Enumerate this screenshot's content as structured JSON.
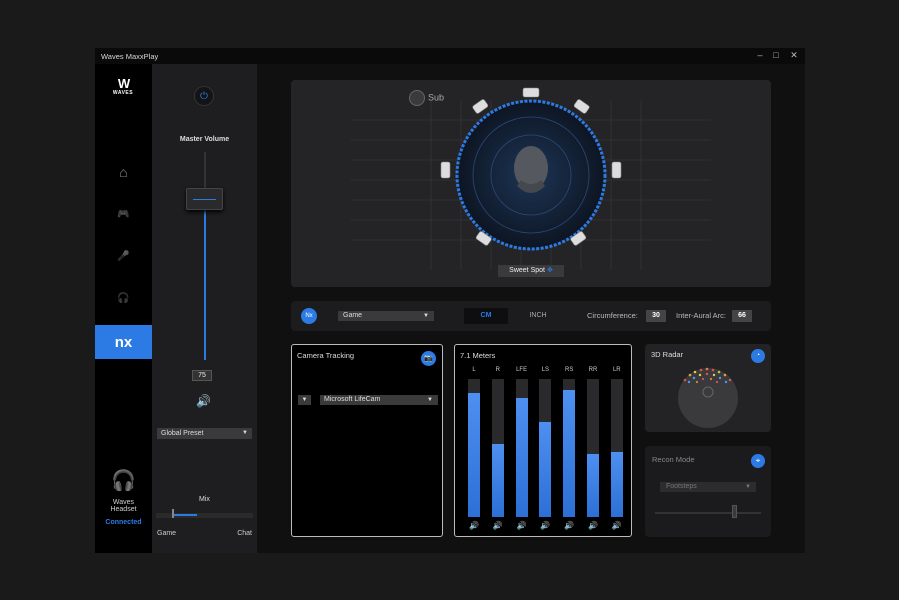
{
  "window": {
    "title": "Waves MaxxPlay",
    "minimize": "–",
    "maximize": "□",
    "close": "✕"
  },
  "rail": {
    "logo_mark": "W",
    "logo_text": "WAVES",
    "items": [
      {
        "icon": "home-icon",
        "glyph": "⌂"
      },
      {
        "icon": "gamepad-icon",
        "glyph": "🎮"
      },
      {
        "icon": "microphone-icon",
        "glyph": "🎤"
      },
      {
        "icon": "headphones-icon",
        "glyph": "🎧"
      },
      {
        "icon": "nx-icon",
        "glyph": "nx",
        "active": true
      }
    ],
    "headset_name": "Waves Headset",
    "headset_status": "Connected"
  },
  "mixer": {
    "master_label": "Master Volume",
    "volume_value": "75",
    "volume_level": 0.75,
    "preset_label": "Global Preset",
    "mix_label": "Mix",
    "mix_left": "Game",
    "mix_right": "Chat",
    "mix_level": 0.2
  },
  "stage": {
    "sub_label": "Sub",
    "sweet_spot_label": "Sweet Spot",
    "sweet_spot_icon": "✥"
  },
  "controls": {
    "nx_badge": "Nx",
    "profile": "Game",
    "unit_cm": "CM",
    "unit_inch": "INCH",
    "circumference_label": "Circumference:",
    "circumference_value": "30",
    "interaural_label": "Inter-Aural Arc:",
    "interaural_value": "66"
  },
  "camera": {
    "title": "Camera Tracking",
    "device": "Microsoft LifeCam"
  },
  "meters": {
    "title": "7.1 Meters",
    "channels": [
      {
        "name": "L",
        "level": 0.9
      },
      {
        "name": "R",
        "level": 0.53
      },
      {
        "name": "LFE",
        "level": 0.86
      },
      {
        "name": "LS",
        "level": 0.69
      },
      {
        "name": "RS",
        "level": 0.92
      },
      {
        "name": "RR",
        "level": 0.46
      },
      {
        "name": "LR",
        "level": 0.47
      }
    ]
  },
  "radar": {
    "title": "3D Radar"
  },
  "recon": {
    "title": "Recon Mode",
    "mode": "Footsteps"
  },
  "colors": {
    "accent": "#2c7be5",
    "background": "#101011",
    "panel": "#1f1f21"
  }
}
